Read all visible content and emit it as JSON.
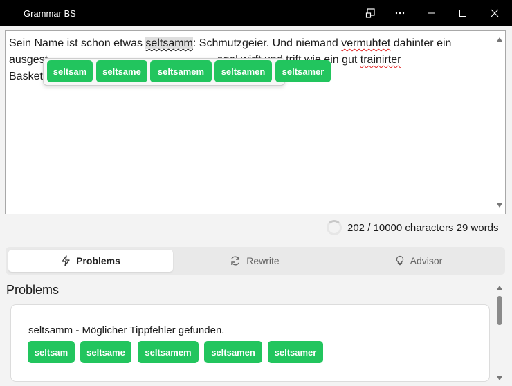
{
  "window": {
    "title": "Grammar BS"
  },
  "editor": {
    "segments": [
      {
        "text": "Sein Name ist schon etwas ",
        "style": "plain"
      },
      {
        "text": "seltsamm",
        "style": "highlight"
      },
      {
        "text": ": Schmutzgeier. Und niemand ",
        "style": "plain"
      },
      {
        "text": "vermuhtet",
        "style": "error"
      },
      {
        "text": " dahinter ein\nausgest",
        "style": "plain"
      },
      {
        "text": "                                                       ",
        "style": "plain"
      },
      {
        "text": "ogel wirft",
        "style": "plain"
      },
      {
        "text": " und ",
        "style": "plain"
      },
      {
        "text": "trift",
        "style": "error"
      },
      {
        "text": " wie ein gut ",
        "style": "plain"
      },
      {
        "text": "trainirter",
        "style": "error"
      },
      {
        "text": "\nBasketb",
        "style": "plain"
      }
    ]
  },
  "popup": {
    "suggestions": [
      "seltsam",
      "seltsame",
      "seltsamem",
      "seltsamen",
      "seltsamer"
    ]
  },
  "counter": {
    "text": "202 / 10000 characters 29 words"
  },
  "tabs": [
    {
      "label": "Problems",
      "icon": "lightning-icon",
      "active": true
    },
    {
      "label": "Rewrite",
      "icon": "refresh-icon",
      "active": false
    },
    {
      "label": "Advisor",
      "icon": "lightbulb-icon",
      "active": false
    }
  ],
  "problems": {
    "title": "Problems",
    "items": [
      {
        "message": "seltsamm - Möglicher Tippfehler gefunden.",
        "suggestions": [
          "seltsam",
          "seltsame",
          "seltsamem",
          "seltsamen",
          "seltsamer"
        ]
      }
    ]
  },
  "colors": {
    "accent_green": "#22c55e",
    "error_red": "#e02020",
    "titlebar": "#000000"
  }
}
